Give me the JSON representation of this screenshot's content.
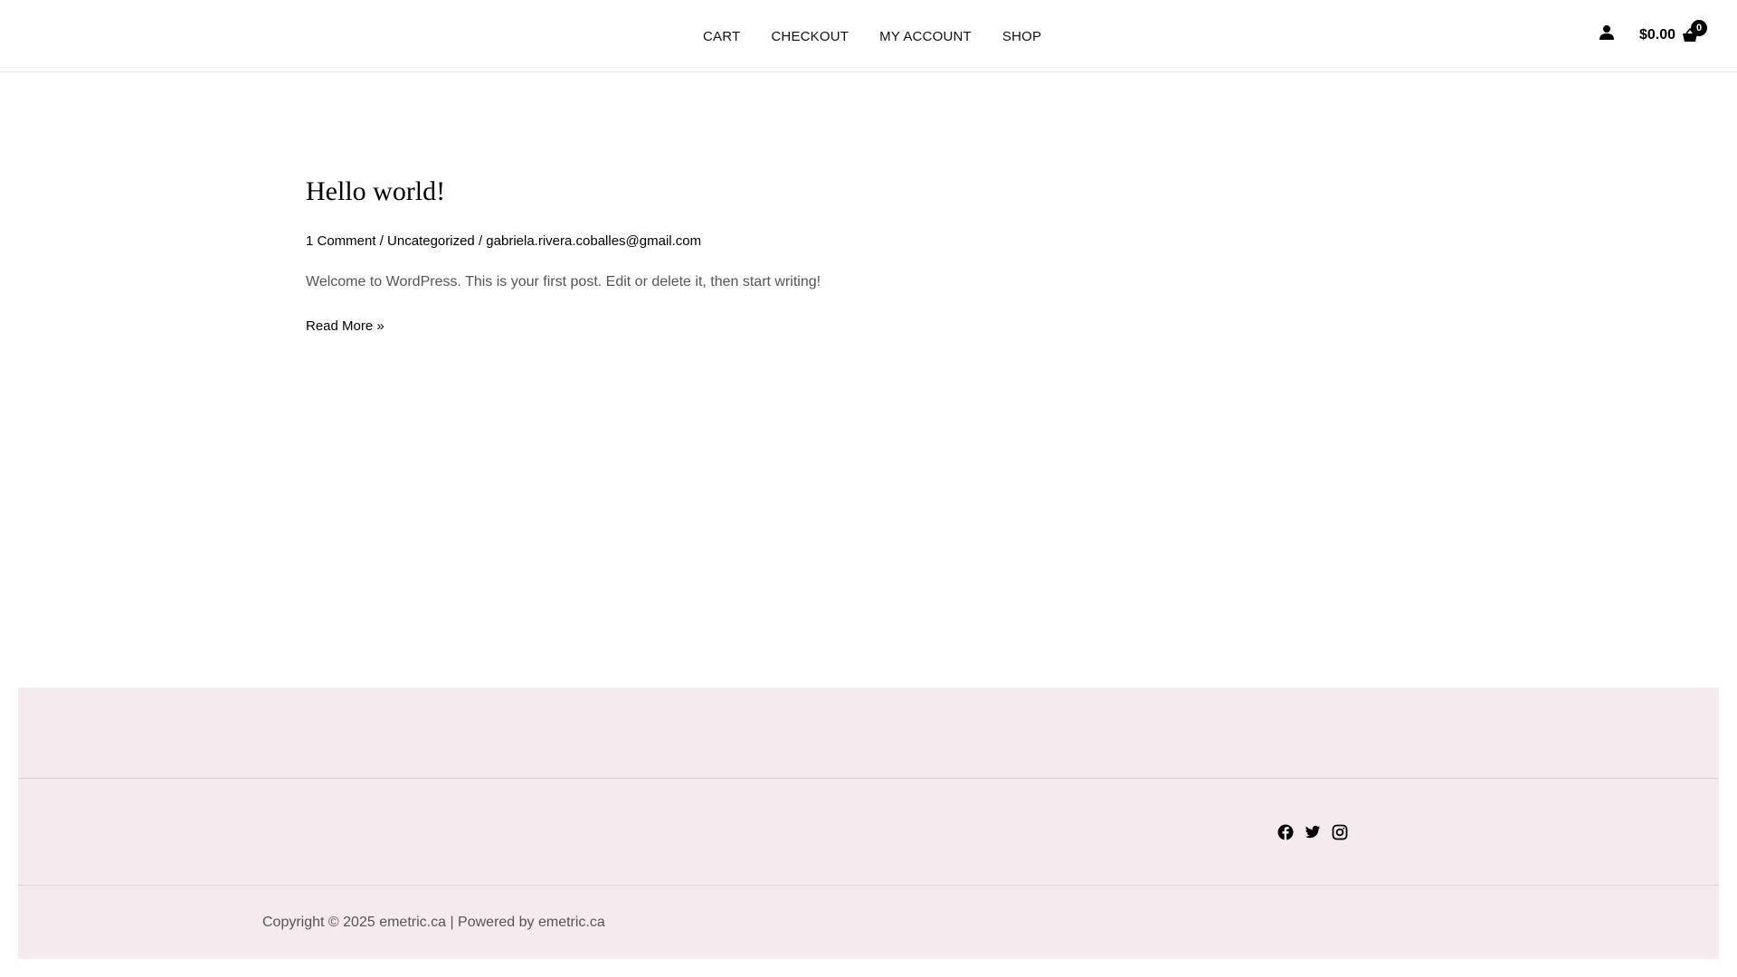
{
  "header": {
    "nav": [
      {
        "label": "CART"
      },
      {
        "label": "CHECKOUT"
      },
      {
        "label": "MY ACCOUNT"
      },
      {
        "label": "SHOP"
      }
    ],
    "account_icon": "user-icon",
    "cart": {
      "total": "$0.00",
      "count": "0",
      "icon": "basket-icon"
    }
  },
  "post": {
    "title": "Hello world!",
    "meta": {
      "comments": "1 Comment",
      "separator": " / ",
      "category": "Uncategorized",
      "author": "gabriela.rivera.coballes@gmail.com"
    },
    "excerpt": "Welcome to WordPress. This is your first post. Edit or delete it, then start writing!",
    "read_more": "Read More »"
  },
  "footer": {
    "background": "#f5ebee",
    "social": [
      {
        "icon": "facebook-icon"
      },
      {
        "icon": "twitter-icon"
      },
      {
        "icon": "instagram-icon"
      }
    ],
    "copyright": "Copyright © 2025 emetric.ca | Powered by emetric.ca"
  }
}
